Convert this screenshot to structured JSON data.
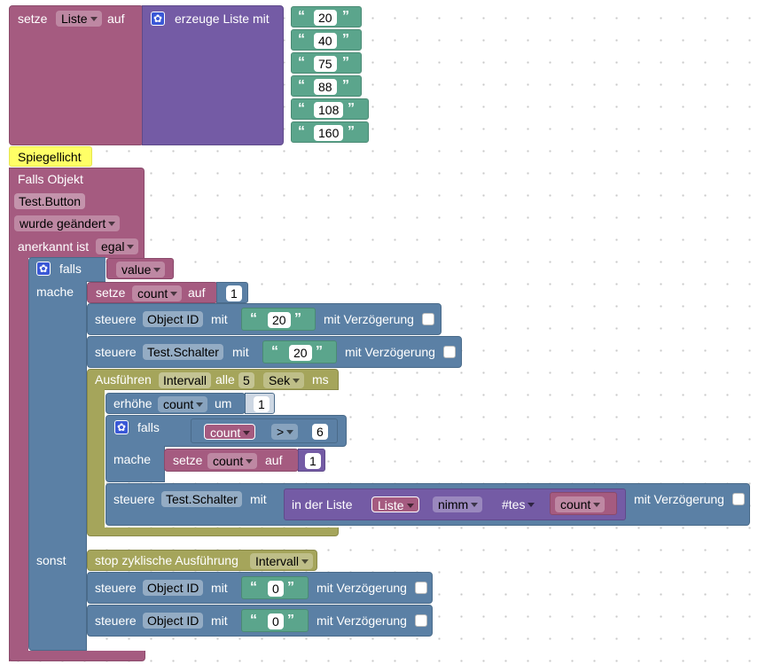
{
  "list_block": {
    "set_label": "setze",
    "variable": "Liste",
    "to_label": "auf",
    "create_label": "erzeuge Liste mit",
    "items": [
      "20",
      "40",
      "75",
      "88",
      "108",
      "160"
    ]
  },
  "comment": "Spiegellicht",
  "trigger": {
    "if_object_label": "Falls Objekt",
    "object": "Test.Button",
    "changed_option": "wurde geändert",
    "ack_label": "anerkannt ist",
    "ack_option": "egal"
  },
  "if_block": {
    "if_label": "falls",
    "condition": "value",
    "do_label": "mache",
    "else_label": "sonst"
  },
  "do_branch": {
    "set_count": {
      "label": "setze",
      "variable": "count",
      "to_label": "auf",
      "value": "1"
    },
    "control1": {
      "label": "steuere",
      "object": "Object ID",
      "with_label": "mit",
      "value": "20",
      "delay_label": "mit Verzögerung"
    },
    "control2": {
      "label": "steuere",
      "object": "Test.Schalter",
      "with_label": "mit",
      "value": "20",
      "delay_label": "mit Verzögerung"
    },
    "interval": {
      "label": "Ausführen",
      "name": "Intervall",
      "every_label": "alle",
      "value": "5",
      "unit": "Sek",
      "ms_label": "ms"
    },
    "increase": {
      "label": "erhöhe",
      "variable": "count",
      "by_label": "um",
      "value": "1"
    },
    "inner_if": {
      "if_label": "falls",
      "left": "count",
      "operator": ">",
      "right": "6",
      "do_label": "mache"
    },
    "inner_set": {
      "label": "setze",
      "variable": "count",
      "to_label": "auf",
      "value": "1"
    },
    "control3": {
      "label": "steuere",
      "object": "Test.Schalter",
      "with_label": "mit",
      "in_list_label": "in der Liste",
      "list": "Liste",
      "take": "nimm",
      "nth": "#tes",
      "index": "count",
      "delay_label": "mit Verzögerung"
    }
  },
  "else_branch": {
    "stop": {
      "label": "stop zyklische Ausführung",
      "name": "Intervall"
    },
    "control1": {
      "label": "steuere",
      "object": "Object ID",
      "with_label": "mit",
      "value": "0",
      "delay_label": "mit Verzögerung"
    },
    "control2": {
      "label": "steuere",
      "object": "Object ID",
      "with_label": "mit",
      "value": "0",
      "delay_label": "mit Verzögerung"
    }
  }
}
